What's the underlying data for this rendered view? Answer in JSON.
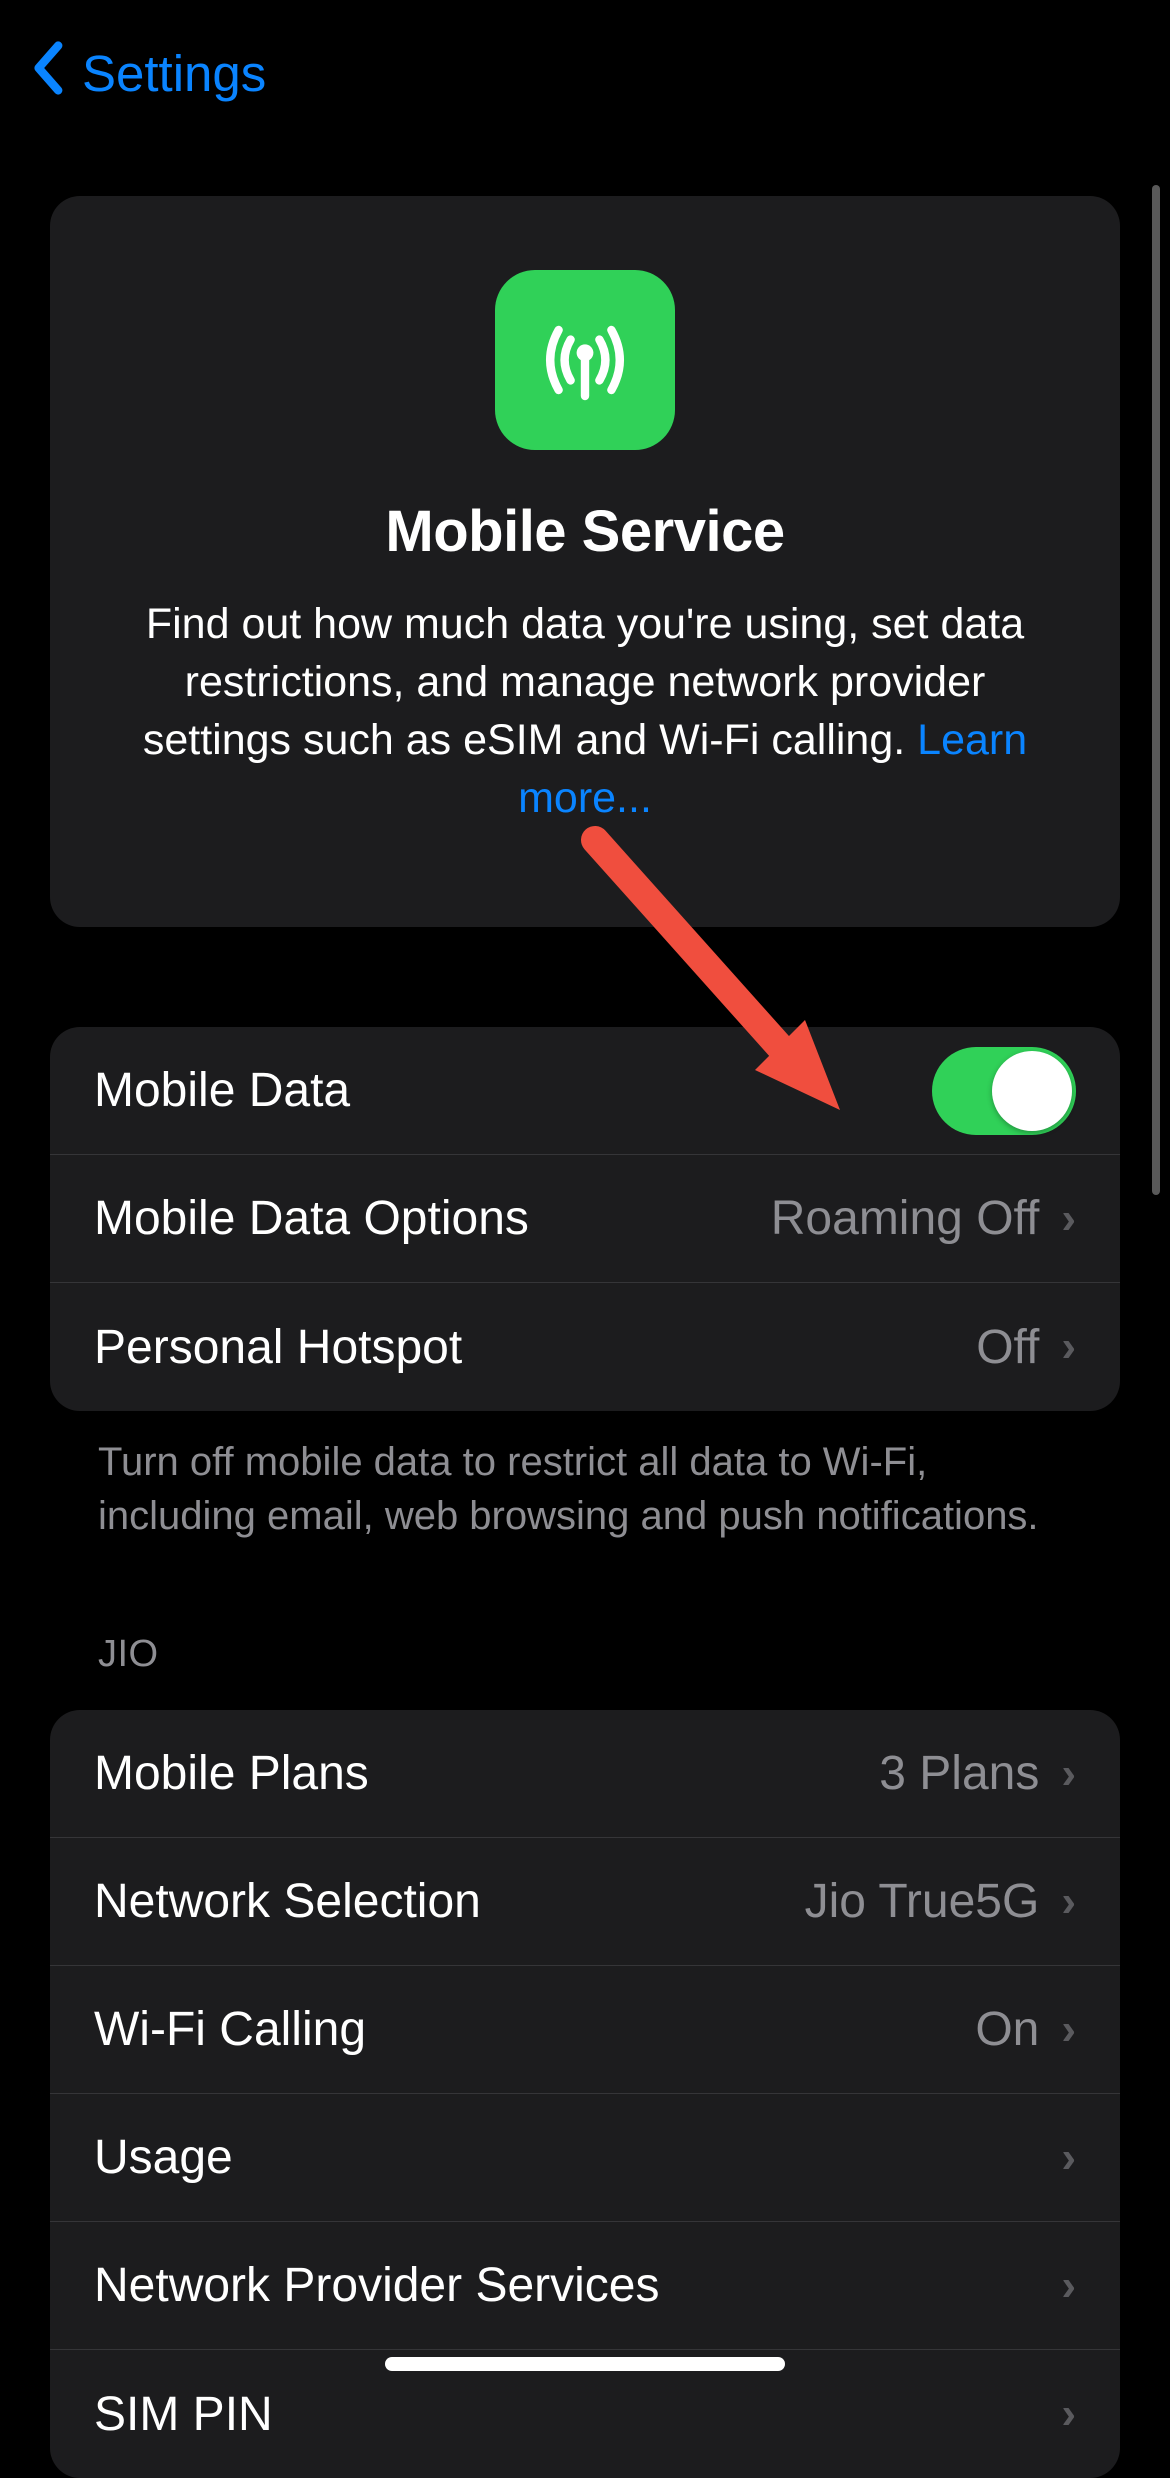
{
  "header": {
    "back_label": "Settings"
  },
  "hero": {
    "title": "Mobile Service",
    "description": "Find out how much data you're using, set data restrictions, and manage network provider settings such as eSIM and Wi-Fi calling. ",
    "link_text": "Learn more..."
  },
  "group1": {
    "mobile_data_label": "Mobile Data",
    "mobile_data_on": true,
    "options_label": "Mobile Data Options",
    "options_value": "Roaming Off",
    "hotspot_label": "Personal Hotspot",
    "hotspot_value": "Off",
    "footer": "Turn off mobile data to restrict all data to Wi-Fi, including email, web browsing and push notifications."
  },
  "carrier_section": {
    "header": "JIO",
    "plans_label": "Mobile Plans",
    "plans_value": "3 Plans",
    "network_label": "Network Selection",
    "network_value": "Jio True5G",
    "wifi_calling_label": "Wi-Fi Calling",
    "wifi_calling_value": "On",
    "usage_label": "Usage",
    "provider_services_label": "Network Provider Services",
    "sim_pin_label": "SIM PIN"
  }
}
